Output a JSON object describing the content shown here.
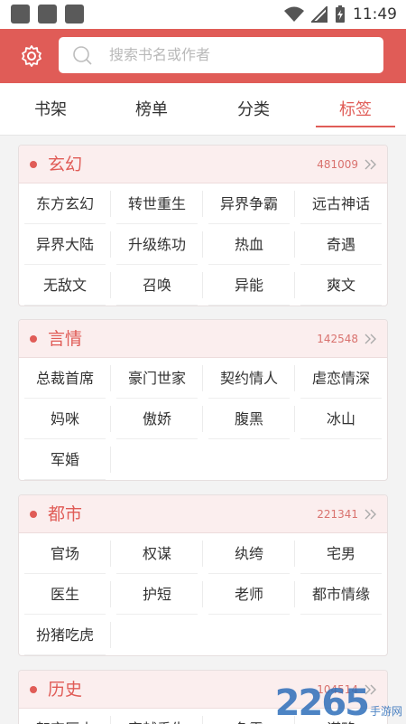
{
  "status_bar": {
    "time": "11:49"
  },
  "header": {
    "search_placeholder": "搜索书名或作者"
  },
  "tabs": [
    {
      "label": "书架"
    },
    {
      "label": "榜单"
    },
    {
      "label": "分类"
    },
    {
      "label": "标签"
    }
  ],
  "active_tab": "标签",
  "colors": {
    "accent": "#e05c57",
    "header_bg": "#e05c57",
    "card_head_bg": "#fbeeee"
  },
  "categories": [
    {
      "title": "玄幻",
      "count": "481009",
      "tags": [
        "东方玄幻",
        "转世重生",
        "异界争霸",
        "远古神话",
        "异界大陆",
        "升级练功",
        "热血",
        "奇遇",
        "无敌文",
        "召唤",
        "异能",
        "爽文"
      ]
    },
    {
      "title": "言情",
      "count": "142548",
      "tags": [
        "总裁首席",
        "豪门世家",
        "契约情人",
        "虐恋情深",
        "妈咪",
        "傲娇",
        "腹黑",
        "冰山",
        "军婚"
      ]
    },
    {
      "title": "都市",
      "count": "221341",
      "tags": [
        "官场",
        "权谋",
        "纨绔",
        "宅男",
        "医生",
        "护短",
        "老师",
        "都市情缘",
        "扮猪吃虎"
      ]
    },
    {
      "title": "历史",
      "count": "104514",
      "tags": [
        "架空历史",
        "穿越重生",
        "争霸",
        "谋略"
      ]
    }
  ],
  "watermark": {
    "number": "2265",
    "text": "手游网"
  }
}
